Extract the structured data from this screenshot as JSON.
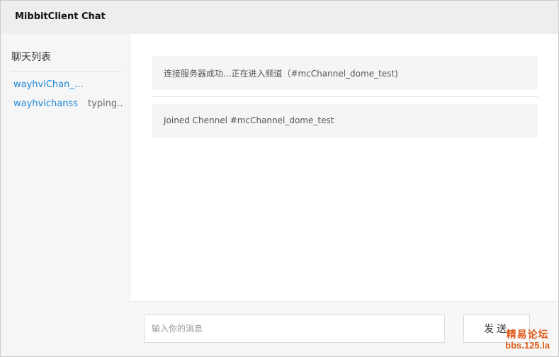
{
  "app": {
    "title": "MibbitClient Chat"
  },
  "sidebar": {
    "heading": "聊天列表",
    "chats": [
      {
        "name": "wayhviChan_d...",
        "status": ""
      },
      {
        "name": "wayhvichanss",
        "status": "typing.."
      }
    ]
  },
  "messages": [
    "连接服务器成功...正在进入频道（#mcChannel_dome_test)",
    "Joined Chennel #mcChannel_dome_test"
  ],
  "composer": {
    "placeholder": "输入你的消息",
    "value": "",
    "send_label": "发送"
  },
  "watermark": {
    "line1": "精易论坛",
    "line2": "bbs.125.la"
  },
  "colors": {
    "link": "#1e88d8",
    "watermark": "#e05a1a"
  }
}
